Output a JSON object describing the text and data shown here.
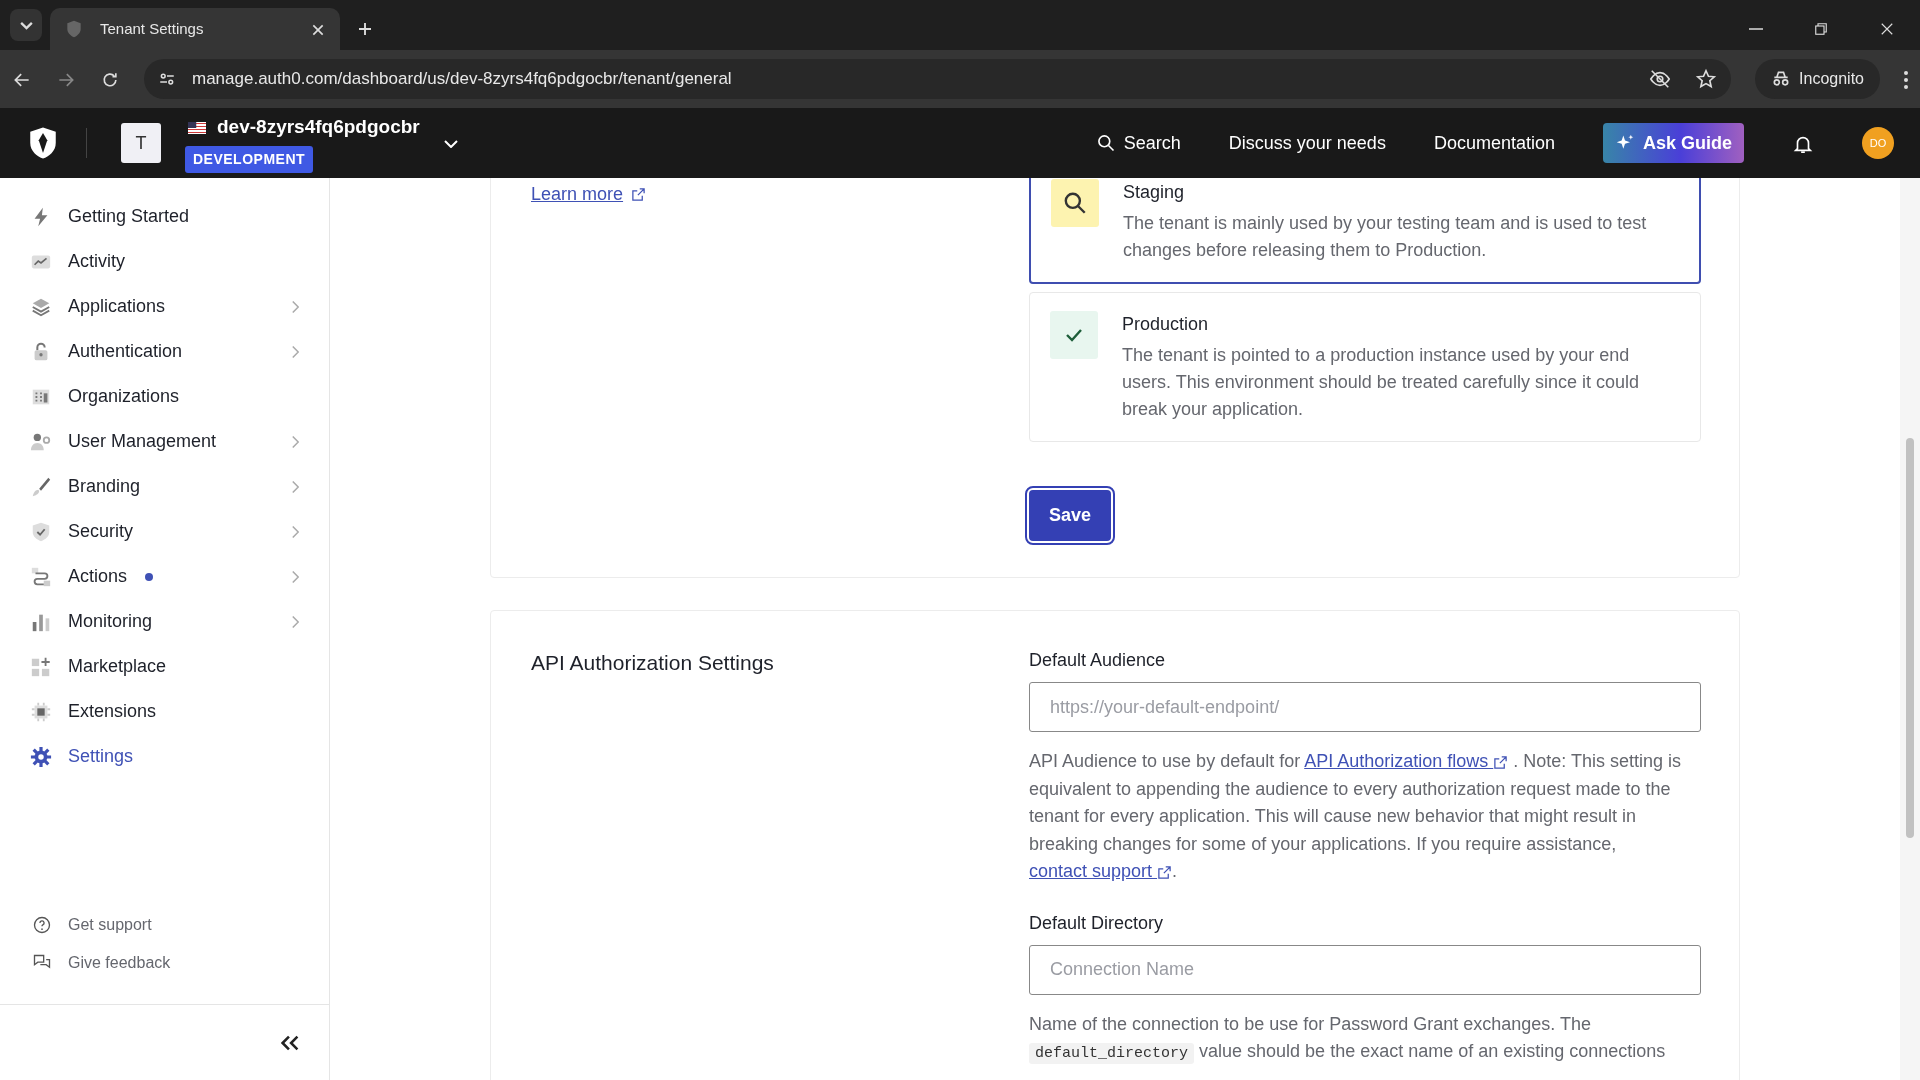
{
  "browser": {
    "tab_title": "Tenant Settings",
    "url": "manage.auth0.com/dashboard/us/dev-8zyrs4fq6pdgocbr/tenant/general",
    "profile": "Incognito"
  },
  "header": {
    "tenant_initial": "T",
    "tenant_name": "dev-8zyrs4fq6pdgocbr",
    "environment": "DEVELOPMENT",
    "search": "Search",
    "links": [
      "Discuss your needs",
      "Documentation"
    ],
    "guide_button": "Ask Guide",
    "avatar": "DO"
  },
  "sidebar": {
    "items": [
      {
        "label": "Getting Started",
        "has_submenu": false,
        "selected": false,
        "new_dot": false
      },
      {
        "label": "Activity",
        "has_submenu": false,
        "selected": false,
        "new_dot": false
      },
      {
        "label": "Applications",
        "has_submenu": true,
        "selected": false,
        "new_dot": false
      },
      {
        "label": "Authentication",
        "has_submenu": true,
        "selected": false,
        "new_dot": false
      },
      {
        "label": "Organizations",
        "has_submenu": false,
        "selected": false,
        "new_dot": false
      },
      {
        "label": "User Management",
        "has_submenu": true,
        "selected": false,
        "new_dot": false
      },
      {
        "label": "Branding",
        "has_submenu": true,
        "selected": false,
        "new_dot": false
      },
      {
        "label": "Security",
        "has_submenu": true,
        "selected": false,
        "new_dot": false
      },
      {
        "label": "Actions",
        "has_submenu": true,
        "selected": false,
        "new_dot": true
      },
      {
        "label": "Monitoring",
        "has_submenu": true,
        "selected": false,
        "new_dot": false
      },
      {
        "label": "Marketplace",
        "has_submenu": false,
        "selected": false,
        "new_dot": false
      },
      {
        "label": "Extensions",
        "has_submenu": false,
        "selected": false,
        "new_dot": false
      },
      {
        "label": "Settings",
        "has_submenu": false,
        "selected": true,
        "new_dot": false
      }
    ],
    "footer": [
      "Get support",
      "Give feedback"
    ]
  },
  "environment_section": {
    "learn_more": "Learn more",
    "options": [
      {
        "title": "Staging",
        "description": "The tenant is mainly used by your testing team and is used to test changes before releasing them to Production.",
        "selected": true
      },
      {
        "title": "Production",
        "description": "The tenant is pointed to a production instance used by your end users. This environment should be treated carefully since it could break your application.",
        "selected": false
      }
    ],
    "save_button": "Save"
  },
  "api_section": {
    "title": "API Authorization Settings",
    "fields": [
      {
        "label": "Default Audience",
        "placeholder": "https://your-default-endpoint/",
        "help": [
          {
            "kind": "text",
            "text": "API Audience to use by default for "
          },
          {
            "kind": "link",
            "text": "API Authorization flows"
          },
          {
            "kind": "text",
            "text": " . Note: This setting is equivalent to appending the audience to every authorization request made to the tenant for every application. This will cause new behavior that might result in breaking changes for some of your applications. If you require assistance, "
          },
          {
            "kind": "link",
            "text": "contact support"
          },
          {
            "kind": "text",
            "text": "."
          }
        ]
      },
      {
        "label": "Default Directory",
        "placeholder": "Connection Name",
        "help": [
          {
            "kind": "text",
            "text": "Name of the connection to be use for Password Grant exchanges. The "
          },
          {
            "kind": "code",
            "text": "default_directory"
          },
          {
            "kind": "text",
            "text": " value should be the exact name of an existing connections"
          }
        ]
      }
    ]
  }
}
